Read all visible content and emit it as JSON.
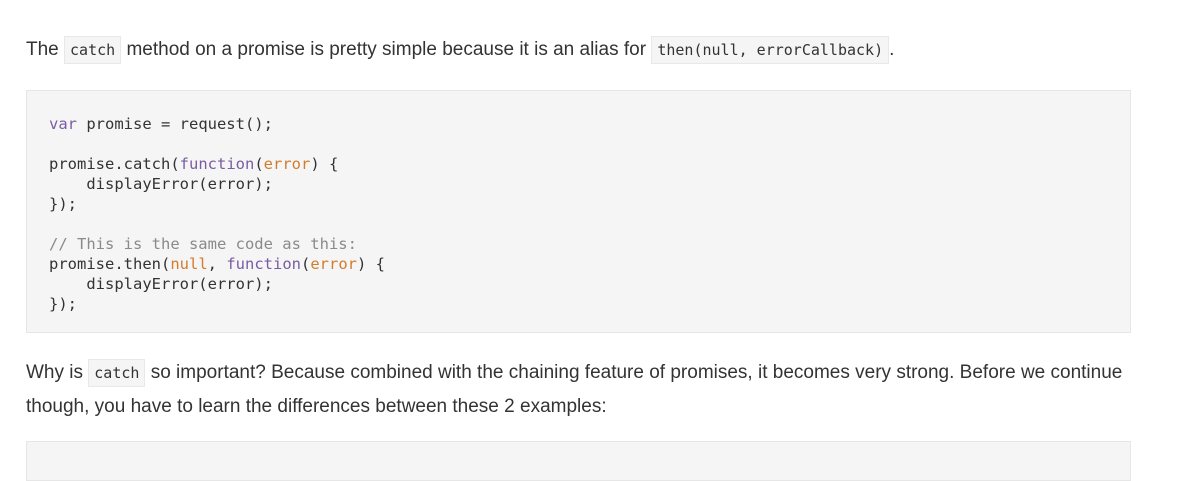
{
  "para1": {
    "text_a": "The ",
    "code_a": "catch",
    "text_b": " method on a promise is pretty simple because it is an alias for ",
    "code_b": "then(null, errorCallback)",
    "text_c": "."
  },
  "code_block": {
    "line1": {
      "kw": "var",
      "rest": " promise = request();"
    },
    "line3": {
      "a": "promise.catch(",
      "kw": "function",
      "b": "(",
      "arg": "error",
      "c": ") {"
    },
    "line4": "    displayError(error);",
    "line5": "});",
    "line7": "// This is the same code as this:",
    "line8": {
      "a": "promise.then(",
      "nul": "null",
      "b": ", ",
      "kw": "function",
      "c": "(",
      "arg": "error",
      "d": ") {"
    },
    "line9": "    displayError(error);",
    "line10": "});"
  },
  "para2": {
    "text_a": "Why is ",
    "code_a": "catch",
    "text_b": " so important? Because combined with the chaining feature of promises, it becomes very strong. Before we continue though, you have to learn the differences between these 2 examples:"
  }
}
